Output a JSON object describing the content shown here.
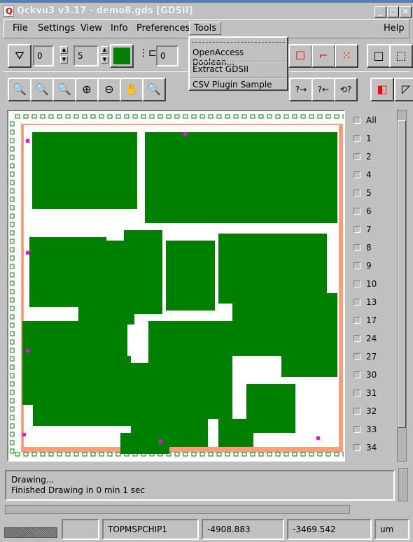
{
  "window": {
    "title": "Qckvu3 v3.17 - demo8.gds [GDSII]",
    "minimize": "_",
    "maximize": "□",
    "close": "✕"
  },
  "menu": {
    "items": [
      "File",
      "Settings",
      "View",
      "Info",
      "Preferences",
      "Tools"
    ],
    "help": "Help",
    "open": "Tools"
  },
  "tools_menu": {
    "items": [
      "OpenAccess Boolean...",
      "Extract GDSII",
      "CSV Plugin Sample"
    ]
  },
  "toolbar1": {
    "field1": "0",
    "field2": "5",
    "field3": "0",
    "color": "#008000"
  },
  "layers": {
    "items": [
      "All",
      "1",
      "2",
      "4",
      "5",
      "6",
      "7",
      "8",
      "9",
      "10",
      "13",
      "17",
      "24",
      "27",
      "30",
      "31",
      "32",
      "33",
      "34"
    ]
  },
  "layout_colors": {
    "green": "#008000",
    "salmon": "#f4a07c",
    "pad": "#ff00ff"
  },
  "status": {
    "lines": [
      "Drawing...",
      "Finished Drawing in 0 min 1 sec"
    ]
  },
  "statusbar": {
    "cell": "TOPMSPCHIP1",
    "x": "-4908.883",
    "y": "-3469.542",
    "units": "um"
  }
}
